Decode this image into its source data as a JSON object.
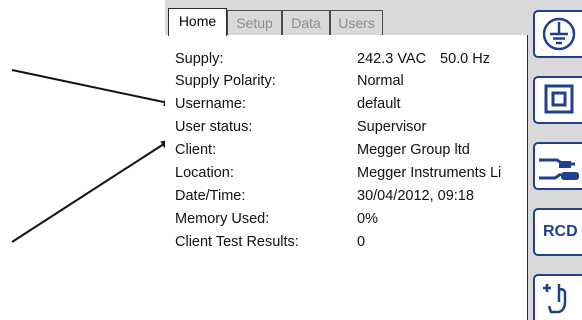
{
  "tabs": [
    {
      "label": "Home"
    },
    {
      "label": "Setup"
    },
    {
      "label": "Data"
    },
    {
      "label": "Users"
    }
  ],
  "rows": [
    {
      "label": "Supply:",
      "value": "242.3 VAC",
      "value2": "50.0 Hz"
    },
    {
      "label": "Supply Polarity:",
      "value": "Normal"
    },
    {
      "label": "Username:",
      "value": "default"
    },
    {
      "label": "User status:",
      "value": "Supervisor"
    },
    {
      "label": "Client:",
      "value": "Megger Group ltd"
    },
    {
      "label": "Location:",
      "value": "Megger Instruments Li"
    },
    {
      "label": "Date/Time:",
      "value": "30/04/2012, 09:18"
    },
    {
      "label": "Memory Used:",
      "value": "0%"
    },
    {
      "label": "Client Test Results:",
      "value": "0"
    }
  ],
  "sidebar": {
    "rcd_label": "RCD",
    "icons": [
      "earth-ground-icon",
      "class-ii-insulation-icon",
      "plug-lead-icon",
      "rcd-icon",
      "touch-probe-icon"
    ]
  },
  "colors": {
    "accent": "#1f3f8f",
    "device_bg": "#d9d9d9",
    "inactive_tab_text": "#8c8c8c"
  }
}
